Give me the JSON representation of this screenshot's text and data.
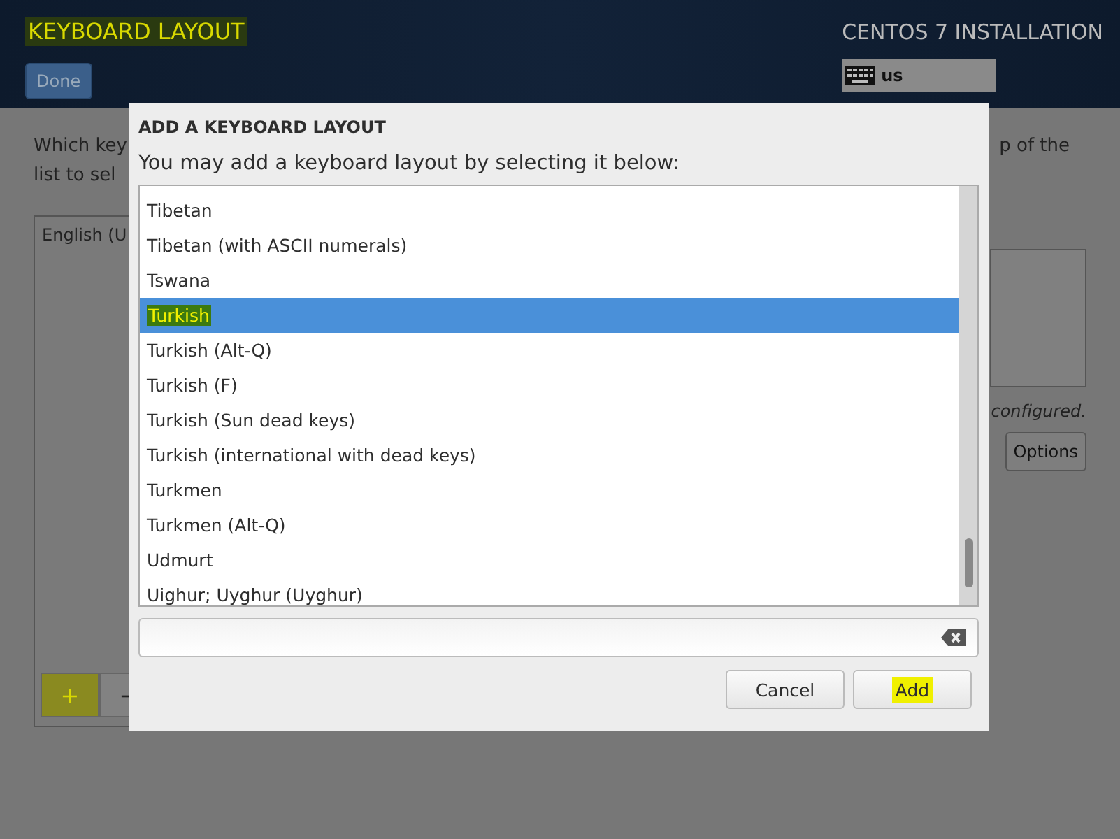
{
  "header": {
    "title": "KEYBOARD LAYOUT",
    "title_highlighted": true,
    "done_button": "Done",
    "product": "CENTOS 7 INSTALLATION",
    "layout_indicator": "us"
  },
  "background": {
    "intro_left": "Which key",
    "intro_left_2": "list to sel",
    "intro_right": "p of the",
    "layouts": [
      "English (U"
    ],
    "add_button": {
      "label": "+",
      "highlighted": true
    },
    "remove_button": "−",
    "note": "configured.",
    "options_button": "Options"
  },
  "dialog": {
    "title": "ADD A KEYBOARD LAYOUT",
    "subtitle": "You may add a keyboard layout by selecting it below:",
    "items": [
      {
        "label": "Tibetan",
        "selected": false,
        "highlighted": false
      },
      {
        "label": "Tibetan (with ASCII numerals)",
        "selected": false,
        "highlighted": false
      },
      {
        "label": "Tswana",
        "selected": false,
        "highlighted": false
      },
      {
        "label": "Turkish",
        "selected": true,
        "highlighted": true
      },
      {
        "label": "Turkish (Alt-Q)",
        "selected": false,
        "highlighted": false
      },
      {
        "label": "Turkish (F)",
        "selected": false,
        "highlighted": false
      },
      {
        "label": "Turkish (Sun dead keys)",
        "selected": false,
        "highlighted": false
      },
      {
        "label": "Turkish (international with dead keys)",
        "selected": false,
        "highlighted": false
      },
      {
        "label": "Turkmen",
        "selected": false,
        "highlighted": false
      },
      {
        "label": "Turkmen (Alt-Q)",
        "selected": false,
        "highlighted": false
      },
      {
        "label": "Udmurt",
        "selected": false,
        "highlighted": false
      },
      {
        "label": "Uighur; Uyghur (Uyghur)",
        "selected": false,
        "highlighted": false
      }
    ],
    "buttons": [
      {
        "label": "Cancel",
        "highlighted": false
      },
      {
        "label": "Add",
        "highlighted": true
      }
    ]
  }
}
